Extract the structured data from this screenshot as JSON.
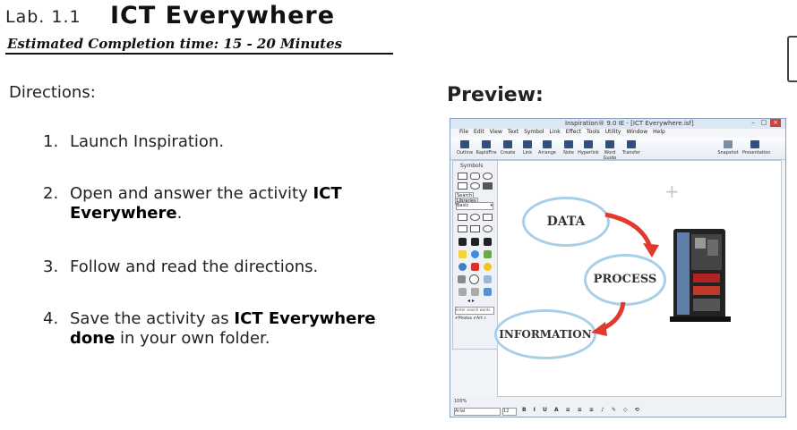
{
  "header": {
    "lab_number": "Lab. 1.1",
    "title": "ICT Everywhere",
    "estimated_time": "Estimated Completion time: 15 - 20 Minutes"
  },
  "directions": {
    "heading": "Directions:",
    "steps": [
      {
        "num": "1.",
        "parts": [
          "Launch Inspiration."
        ]
      },
      {
        "num": "2.",
        "parts": [
          "Open and answer the activity ",
          "ICT",
          "Everywhere",
          "."
        ]
      },
      {
        "num": "3.",
        "parts": [
          "Follow and read the directions."
        ]
      },
      {
        "num": "4.",
        "parts": [
          "Save the activity as ",
          "ICT Everywhere",
          "done",
          " in your own folder."
        ]
      }
    ]
  },
  "preview": {
    "label": "Preview:",
    "app": {
      "window_title": "Inspiration® 9.0 IE - [ICT Everywhere.isf]",
      "menu": [
        "File",
        "Edit",
        "View",
        "Text",
        "Symbol",
        "Link",
        "Effect",
        "Tools",
        "Utility",
        "Window",
        "Help"
      ],
      "toolbar": [
        "Outline",
        "RapidFire",
        "Create",
        "Link",
        "Arrange",
        "Note",
        "Hyperlink",
        "Word Guide",
        "Transfer",
        "Snapshot",
        "Presentation"
      ],
      "symbols_header": "Symbols",
      "search_tab": "Search",
      "libraries_tab": "Libraries",
      "library_select": "Basic",
      "search_placeholder": "Enter search words",
      "photos_label": "Photos",
      "art_label": "Art",
      "zoom": "100%",
      "font": "Arial",
      "font_size": "12",
      "diagram": {
        "node1": "DATA",
        "node2": "PROCESS",
        "node3": "INFORMATION"
      }
    }
  },
  "colors": {
    "bubble_border": "#a8cfe8",
    "arrow": "#e03a2f",
    "toolbar_icon": "#2f4f7f"
  }
}
